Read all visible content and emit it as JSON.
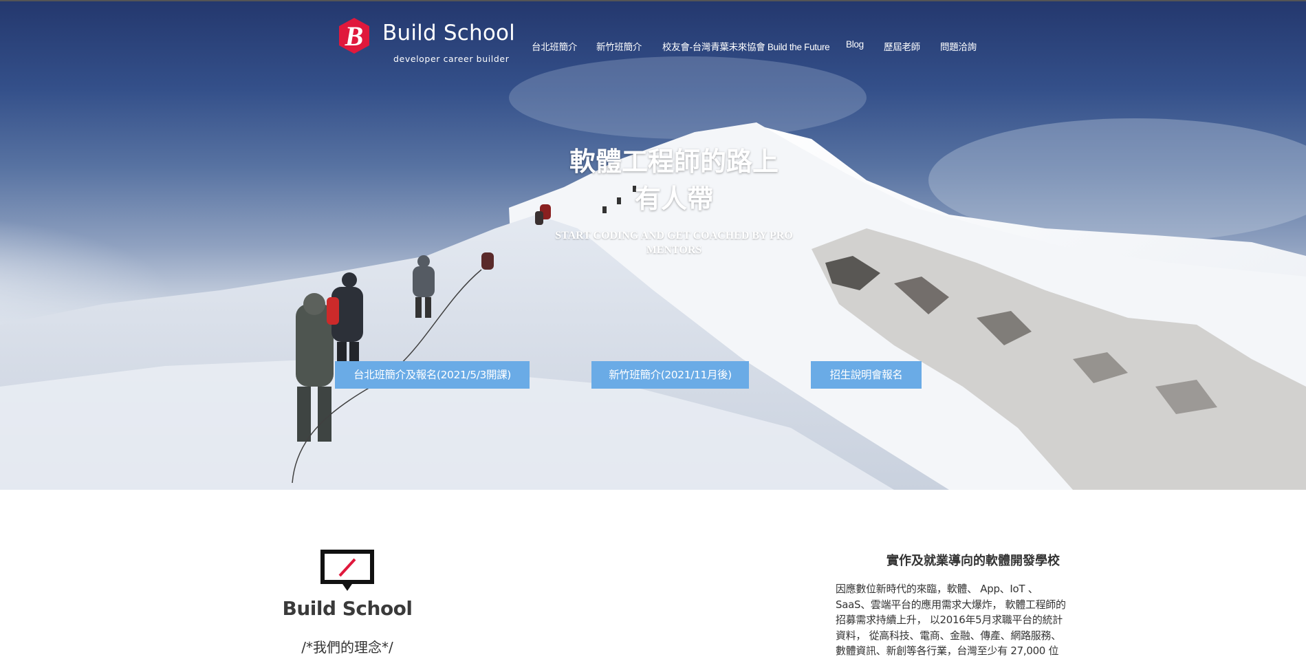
{
  "brand": {
    "logo_letter": "B",
    "name": "Build School",
    "tagline": "developer career builder",
    "accent_color": "#e0183c"
  },
  "nav": {
    "items": [
      {
        "label": "台北班簡介"
      },
      {
        "label": "新竹班簡介"
      },
      {
        "label": "校友會-台灣青葉未來協會 Build the Future"
      },
      {
        "label": "Blog"
      },
      {
        "label": "歷屆老師"
      },
      {
        "label": "問題洽詢"
      }
    ]
  },
  "hero": {
    "title_line1": "軟體工程師的路上",
    "title_line2": "有人帶",
    "subtitle_line1": "START CODING AND GET COACHED BY PRO",
    "subtitle_line2": "MENTORS",
    "buttons": [
      {
        "label": "台北班簡介及報名(2021/5/3開課)"
      },
      {
        "label": "新竹班簡介(2021/11月後)"
      },
      {
        "label": "招生說明會報名"
      }
    ],
    "button_color": "#6aabe6"
  },
  "about": {
    "icon": "slash-screen-icon",
    "brand": "Build School",
    "philosophy": "/*我們的理念*/"
  },
  "intro": {
    "heading": "實作及就業導向的軟體開發學校",
    "lines": [
      "因應數位新時代的來臨，軟體、 App、IoT 、",
      "SaaS、雲端平台的應用需求大爆炸， 軟體工程師的",
      "招募需求持續上升， 以2016年5月求職平台的統計",
      "資料， 從高科技、電商、金融、傳產、網路服務、",
      "數體資訊、新創等各行業，台灣至少有 27,000 位"
    ]
  }
}
